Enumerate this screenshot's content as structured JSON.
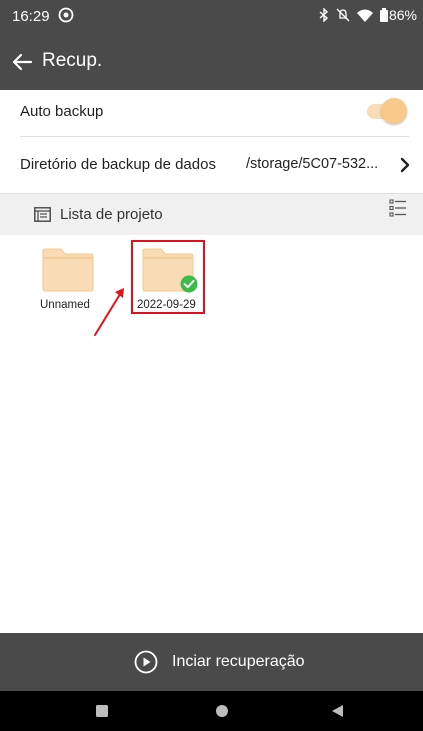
{
  "status_bar": {
    "time": "16:29",
    "battery": "86%"
  },
  "app_bar": {
    "title": "Recup."
  },
  "settings": {
    "auto_backup_label": "Auto backup",
    "auto_backup_on": true,
    "backup_dir_label": "Diretório de backup de dados",
    "backup_dir_value": "/storage/5C07-532..."
  },
  "project_list": {
    "title": "Lista de projeto",
    "folders": [
      {
        "name": "Unnamed",
        "selected": false
      },
      {
        "name": "2022-09-29",
        "selected": true
      }
    ]
  },
  "action": {
    "label": "Inciar recuperação"
  },
  "colors": {
    "bar_bg": "#4a4a4a",
    "folder_fill": "#f9dcb5",
    "folder_tab": "#f2c98d",
    "check_green": "#3dbb4a",
    "highlight_red": "#e0101c"
  }
}
